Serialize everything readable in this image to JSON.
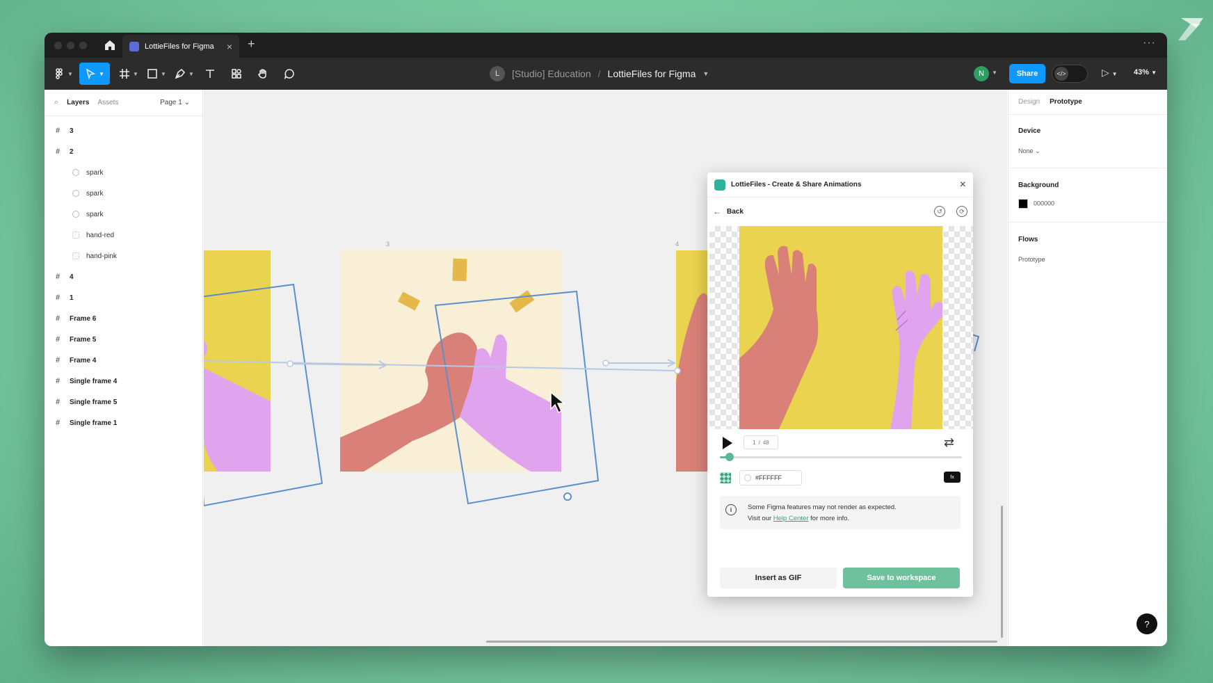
{
  "window": {
    "tab_title": "LottieFiles for Figma",
    "tab_close": "×",
    "tab_add": "+",
    "more": "···"
  },
  "toolbar": {
    "team_initial": "L",
    "team": "[Studio] Education",
    "separator": "/",
    "file": "LottieFiles for Figma",
    "user_initial": "N",
    "share_label": "Share",
    "devmode_label": "</>",
    "zoom": "43%"
  },
  "left_panel": {
    "tabs": {
      "layers": "Layers",
      "assets": "Assets",
      "page": "Page 1 ⌄"
    },
    "layers": [
      {
        "label": "3",
        "kind": "frame"
      },
      {
        "label": "2",
        "kind": "frame"
      },
      {
        "label": "spark",
        "kind": "child"
      },
      {
        "label": "spark",
        "kind": "child"
      },
      {
        "label": "spark",
        "kind": "child"
      },
      {
        "label": "hand-red",
        "kind": "child-sq"
      },
      {
        "label": "hand-pink",
        "kind": "child-sq"
      },
      {
        "label": "4",
        "kind": "frame"
      },
      {
        "label": "1",
        "kind": "frame"
      },
      {
        "label": "Frame 6",
        "kind": "frame"
      },
      {
        "label": "Frame 5",
        "kind": "frame"
      },
      {
        "label": "Frame 4",
        "kind": "frame"
      },
      {
        "label": "Single frame 4",
        "kind": "frame"
      },
      {
        "label": "Single frame 5",
        "kind": "frame"
      },
      {
        "label": "Single frame 1",
        "kind": "frame"
      }
    ]
  },
  "canvas": {
    "frame_labels": [
      "3",
      "4"
    ]
  },
  "right_panel": {
    "tabs": {
      "design": "Design",
      "prototype": "Prototype"
    },
    "device_title": "Device",
    "device_value": "None ⌄",
    "background_title": "Background",
    "background_value": "000000",
    "flows_title": "Flows",
    "flows_value": "Prototype"
  },
  "plugin": {
    "title": "LottieFiles - Create & Share Animations",
    "close": "×",
    "back": "Back",
    "back_arrow": "←",
    "frame_current": "1",
    "frame_sep": "/",
    "frame_total": "48",
    "playback_fraction": 0.04,
    "bg_color": "#FFFFFF",
    "fx_label": "fx",
    "notice_line1": "Some Figma features may not render as expected.",
    "notice_line2_pre": "Visit our",
    "notice_link": "Help Center",
    "notice_line2_post": "for more info.",
    "insert_gif": "Insert as GIF",
    "save_workspace": "Save to workspace"
  },
  "help": "?",
  "colors": {
    "accent_blue": "#0d99ff",
    "lottie_green": "#6fc09d",
    "art_yellow": "#ead34e",
    "hand_red": "#d98078",
    "hand_pink": "#e0a4ef",
    "frame_cream": "#f8efd6"
  }
}
